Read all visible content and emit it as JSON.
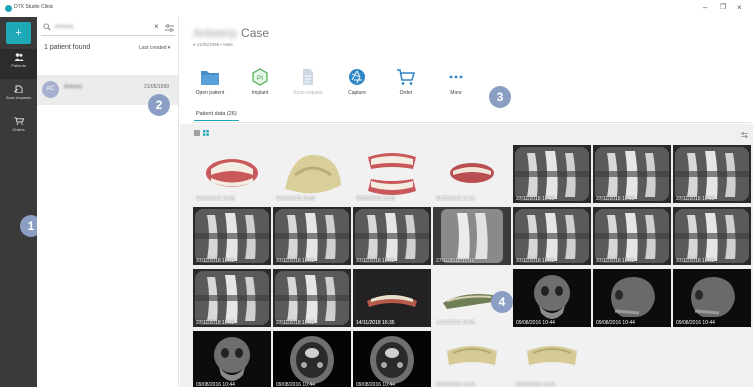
{
  "window": {
    "title": "DTX Studio Clinic",
    "minimize": "–",
    "maximize": "❐",
    "close": "×"
  },
  "nav": {
    "new_label": "+",
    "items": [
      {
        "id": "patients",
        "label": "Patients",
        "icon": "users-icon"
      },
      {
        "id": "scan",
        "label": "Scan requests",
        "icon": "scan-request-icon"
      },
      {
        "id": "orders",
        "label": "Orders",
        "icon": "cart-icon"
      }
    ]
  },
  "patients": {
    "search_value": "Antwerp",
    "clear": "×",
    "found": "1 patient found",
    "sort": "Last created ▾",
    "row": {
      "initials": "AC",
      "name": "Antwerp",
      "dob": "21/05/1999"
    }
  },
  "case": {
    "name_blurred": "Antwerp",
    "title": "Case",
    "subtitle": "♦ 21/05/1999 • Male"
  },
  "toolbar": [
    {
      "id": "open",
      "label": "Open patient",
      "icon": "folder-icon"
    },
    {
      "id": "implant",
      "label": "Implant",
      "icon": "implant-icon"
    },
    {
      "id": "scan",
      "label": "Scan request",
      "icon": "document-icon"
    },
    {
      "id": "capture",
      "label": "Capture",
      "icon": "aperture-icon"
    },
    {
      "id": "order",
      "label": "Order",
      "icon": "cart-icon"
    },
    {
      "id": "more",
      "label": "More",
      "icon": "more-dots-icon"
    }
  ],
  "tab": {
    "label": "Patient data (26)"
  },
  "colors": {
    "accent": "#1aa6b7",
    "nav_bg": "#3a3a3a",
    "callout": "#8a9fc3"
  },
  "thumbnails": [
    {
      "label": "22/09/2019 15:46",
      "kind": "model-pink"
    },
    {
      "label": "22/09/2019 15:46",
      "kind": "model-beige"
    },
    {
      "label": "28/05/2019 16:38",
      "kind": "model-pink-open"
    },
    {
      "label": "21/05/2019 12:16",
      "kind": "model-pink-small"
    },
    {
      "label": "27/11/2018 19:12",
      "kind": "xray"
    },
    {
      "label": "27/11/2018 19:12",
      "kind": "xray"
    },
    {
      "label": "27/11/2018 19:12",
      "kind": "xray"
    },
    {
      "label": "27/11/2018 19:12",
      "kind": "xray"
    },
    {
      "label": "27/11/2018 19:12",
      "kind": "xray"
    },
    {
      "label": "27/11/2018 19:12",
      "kind": "xray"
    },
    {
      "label": "27/11/2018 19:12",
      "kind": "xray-light"
    },
    {
      "label": "27/11/2018 19:12",
      "kind": "xray"
    },
    {
      "label": "27/11/2018 19:12",
      "kind": "xray"
    },
    {
      "label": "27/11/2018 19:12",
      "kind": "xray"
    },
    {
      "label": "27/11/2018 19:12",
      "kind": "xray"
    },
    {
      "label": "27/11/2018 19:12",
      "kind": "xray"
    },
    {
      "label": "14/11/2018 16:35",
      "kind": "model-pink-black"
    },
    {
      "label": "14/11/2018 16:35",
      "kind": "model-green"
    },
    {
      "label": "09/08/2016 10:44",
      "kind": "skull"
    },
    {
      "label": "09/08/2016 10:44",
      "kind": "skull-side"
    },
    {
      "label": "09/08/2016 10:44",
      "kind": "skull-side"
    },
    {
      "label": "09/08/2016 10:44",
      "kind": "skull"
    },
    {
      "label": "09/08/2016 10:44",
      "kind": "ct-axial"
    },
    {
      "label": "09/08/2016 10:44",
      "kind": "ct-axial"
    },
    {
      "label": "03/06/2016 13:24",
      "kind": "model-beige-small"
    },
    {
      "label": "03/06/2016 13:24",
      "kind": "model-beige-small"
    }
  ],
  "callouts": [
    "1",
    "2",
    "3",
    "4"
  ]
}
